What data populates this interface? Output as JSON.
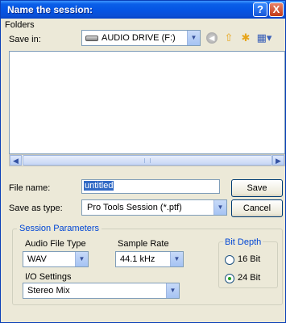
{
  "window": {
    "title": "Name the session:",
    "help_glyph": "?",
    "close_glyph": "X"
  },
  "folders_label": "Folders",
  "save_in": {
    "label": "Save in:",
    "value": "AUDIO DRIVE (F:)",
    "icons": [
      "drive-icon",
      "back-icon",
      "up-folder-icon",
      "new-folder-icon",
      "view-menu-icon"
    ]
  },
  "file_name": {
    "label": "File name:",
    "value": "untitled"
  },
  "save_as_type": {
    "label": "Save as type:",
    "value": "Pro Tools Session (*.ptf)"
  },
  "buttons": {
    "save": "Save",
    "cancel": "Cancel"
  },
  "session_parameters": {
    "title": "Session Parameters",
    "audio_file_type": {
      "label": "Audio File Type",
      "value": "WAV"
    },
    "sample_rate": {
      "label": "Sample Rate",
      "value": "44.1 kHz"
    },
    "io_settings": {
      "label": "I/O Settings",
      "value": "Stereo Mix"
    },
    "bit_depth": {
      "title": "Bit Depth",
      "options": [
        {
          "label": "16 Bit",
          "selected": false
        },
        {
          "label": "24 Bit",
          "selected": true
        }
      ]
    }
  },
  "colors": {
    "titlebar": "#0554e3",
    "dialog_bg": "#ece9d8",
    "group_title": "#0046d5",
    "selection": "#316ac5"
  }
}
